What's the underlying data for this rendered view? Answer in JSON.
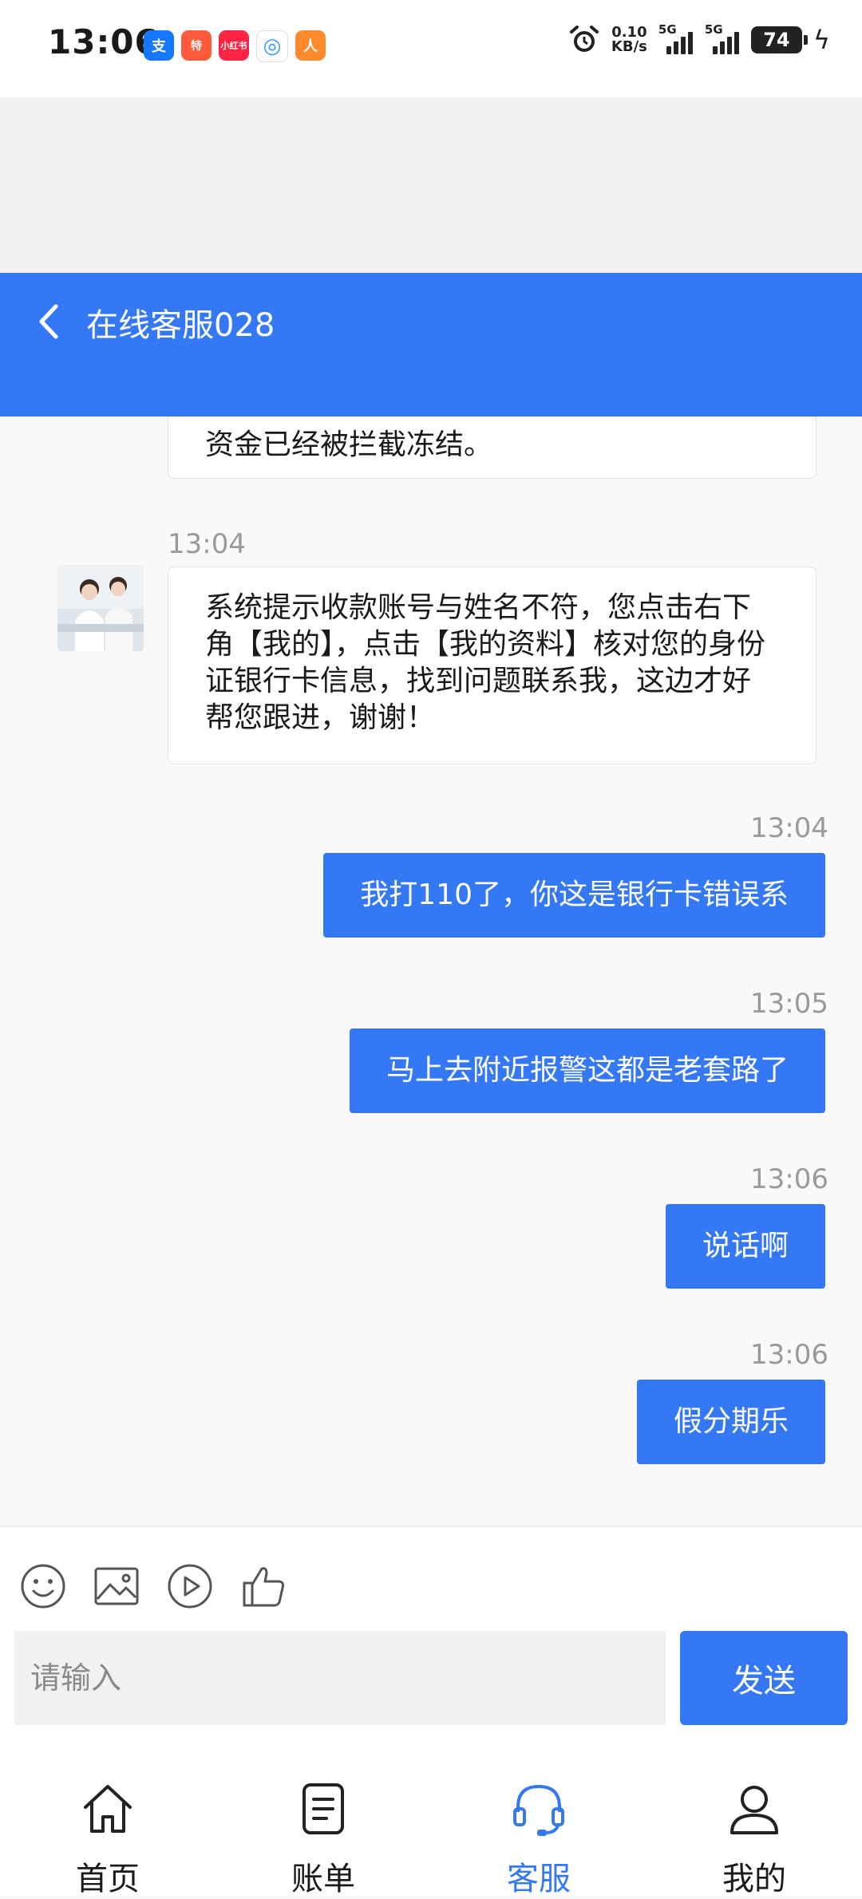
{
  "status_bar": {
    "time": "13:06",
    "app_icons": [
      {
        "name": "alipay-icon",
        "text": "支",
        "color": "#1677ff"
      },
      {
        "name": "taobao-special-icon",
        "text": "特",
        "color": "#ff5a3c"
      },
      {
        "name": "xiaohongshu-icon",
        "text": "小红书",
        "color": "#ff2442"
      },
      {
        "name": "camera-app-icon",
        "text": "◎",
        "color": "#ffffff"
      },
      {
        "name": "cartoon-app-icon",
        "text": "人",
        "color": "#ff8a2b"
      }
    ],
    "speed_value": "0.10",
    "speed_unit": "KB/s",
    "signal_1": "5G",
    "signal_2": "5G",
    "battery": "74"
  },
  "header": {
    "title": "在线客服028"
  },
  "messages": {
    "partial_text": "资金已经被拦截冻结。",
    "agent_time": "13:04",
    "agent_text": "系统提示收款账号与姓名不符，您点击右下角【我的】，点击【我的资料】核对您的身份证银行卡信息，找到问题联系我，这边才好帮您跟进，谢谢！",
    "user": [
      {
        "time": "13:04",
        "text": "我打110了，你这是银行卡错误系"
      },
      {
        "time": "13:05",
        "text": "马上去附近报警这都是老套路了"
      },
      {
        "time": "13:06",
        "text": "说话啊"
      },
      {
        "time": "13:06",
        "text": "假分期乐"
      }
    ]
  },
  "input": {
    "placeholder": "请输入",
    "send_label": "发送"
  },
  "nav": {
    "items": [
      {
        "label": "首页",
        "icon": "home-icon"
      },
      {
        "label": "账单",
        "icon": "bill-icon"
      },
      {
        "label": "客服",
        "icon": "headset-icon",
        "active": true
      },
      {
        "label": "我的",
        "icon": "user-icon"
      }
    ]
  },
  "colors": {
    "accent": "#3478f6"
  }
}
